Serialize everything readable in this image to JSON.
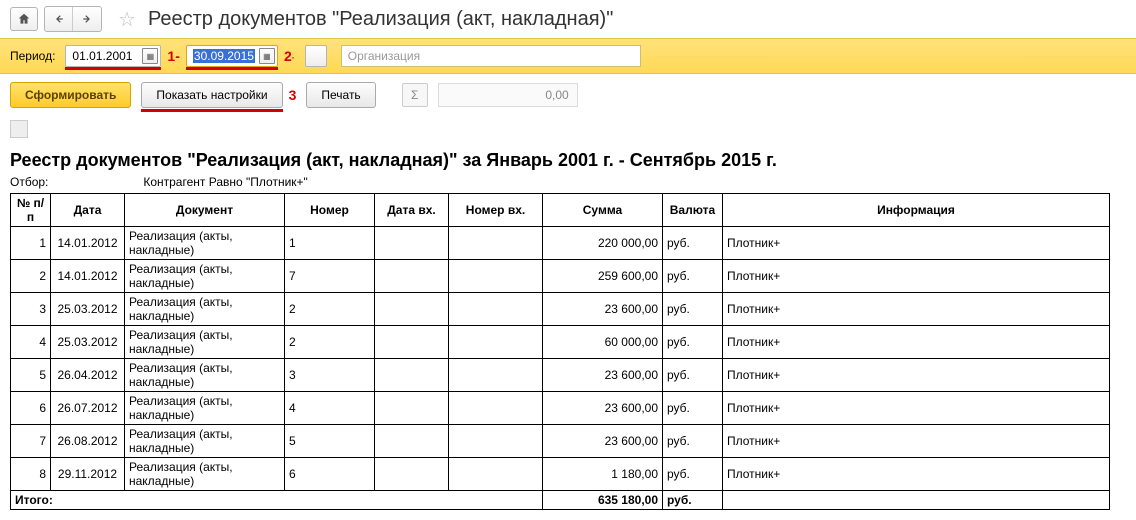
{
  "header": {
    "title": "Реестр документов \"Реализация (акт, накладная)\""
  },
  "period": {
    "label": "Период:",
    "date_from": "01.01.2001",
    "date_to": "30.09.2015",
    "org_placeholder": "Организация",
    "dash": "-",
    "note1": "1",
    "note2": "2",
    "note3": "3"
  },
  "actions": {
    "generate": "Сформировать",
    "show_settings": "Показать настройки",
    "print": "Печать",
    "sigma": "Σ",
    "sum_display": "0,00"
  },
  "report": {
    "title": "Реестр документов \"Реализация (акт, накладная)\"  за Январь 2001 г. - Сентябрь 2015 г.",
    "filter_label": "Отбор:",
    "filter_text": "Контрагент Равно \"Плотник+\"",
    "columns": {
      "num": "№ п/п",
      "date": "Дата",
      "doc": "Документ",
      "nomer": "Номер",
      "in_date": "Дата вх.",
      "in_num": "Номер вх.",
      "sum": "Сумма",
      "cur": "Валюта",
      "info": "Информация"
    },
    "rows": [
      {
        "n": "1",
        "date": "14.01.2012",
        "doc": "Реализация (акты, накладные)",
        "nomer": "1",
        "sum": "220 000,00",
        "cur": "руб.",
        "info": "Плотник+"
      },
      {
        "n": "2",
        "date": "14.01.2012",
        "doc": "Реализация (акты, накладные)",
        "nomer": "7",
        "sum": "259 600,00",
        "cur": "руб.",
        "info": "Плотник+"
      },
      {
        "n": "3",
        "date": "25.03.2012",
        "doc": "Реализация (акты, накладные)",
        "nomer": "2",
        "sum": "23 600,00",
        "cur": "руб.",
        "info": "Плотник+"
      },
      {
        "n": "4",
        "date": "25.03.2012",
        "doc": "Реализация (акты, накладные)",
        "nomer": "2",
        "sum": "60 000,00",
        "cur": "руб.",
        "info": "Плотник+"
      },
      {
        "n": "5",
        "date": "26.04.2012",
        "doc": "Реализация (акты, накладные)",
        "nomer": "3",
        "sum": "23 600,00",
        "cur": "руб.",
        "info": "Плотник+"
      },
      {
        "n": "6",
        "date": "26.07.2012",
        "doc": "Реализация (акты, накладные)",
        "nomer": "4",
        "sum": "23 600,00",
        "cur": "руб.",
        "info": "Плотник+"
      },
      {
        "n": "7",
        "date": "26.08.2012",
        "doc": "Реализация (акты, накладные)",
        "nomer": "5",
        "sum": "23 600,00",
        "cur": "руб.",
        "info": "Плотник+"
      },
      {
        "n": "8",
        "date": "29.11.2012",
        "doc": "Реализация (акты, накладные)",
        "nomer": "6",
        "sum": "1 180,00",
        "cur": "руб.",
        "info": "Плотник+"
      }
    ],
    "total": {
      "label": "Итого:",
      "sum": "635 180,00",
      "cur": "руб."
    }
  }
}
